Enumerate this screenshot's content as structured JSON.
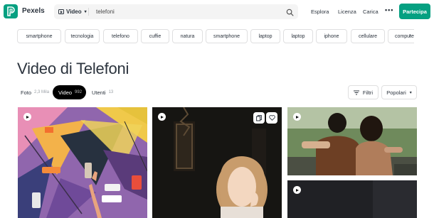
{
  "header": {
    "brand": "Pexels",
    "search": {
      "type_label": "Video",
      "query": "telefoni"
    },
    "nav": [
      "Esplora",
      "Licenza",
      "Carica"
    ],
    "more": "•••",
    "join_label": "Partecipa"
  },
  "chips": [
    "smartphone",
    "tecnologia",
    "telefono",
    "cuffie",
    "natura",
    "smartphone",
    "laptop",
    "laptop",
    "iphone",
    "cellulare",
    "computer"
  ],
  "title": "Video di Telefoni",
  "tabs": [
    {
      "label": "Foto",
      "count": "2,3 Mila",
      "active": false
    },
    {
      "label": "Video",
      "count": "992",
      "active": true
    },
    {
      "label": "Utenti",
      "count": "13",
      "active": false
    }
  ],
  "filters_label": "Filtri",
  "sort_label": "Popolari",
  "colors": {
    "accent": "#05a081",
    "text": "#2c343e"
  }
}
